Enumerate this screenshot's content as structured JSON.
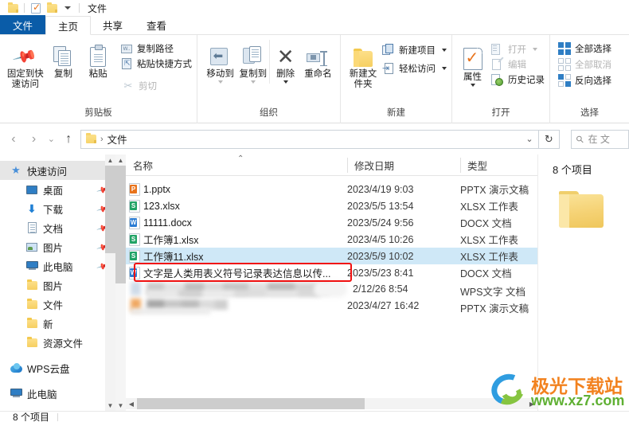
{
  "titlebar": {
    "title": "文件",
    "qat": [
      {
        "name": "folder-icon",
        "label": "文件夹"
      },
      {
        "name": "properties-icon",
        "label": "属性"
      },
      {
        "name": "folder-icon",
        "label": "新建文件夹"
      },
      {
        "name": "chevron-down-icon",
        "label": "自定义快速访问工具栏"
      }
    ]
  },
  "tabs": [
    {
      "id": "file",
      "label": "文件"
    },
    {
      "id": "home",
      "label": "主页"
    },
    {
      "id": "share",
      "label": "共享"
    },
    {
      "id": "view",
      "label": "查看"
    }
  ],
  "ribbon": {
    "groups": [
      {
        "id": "clipboard",
        "label": "剪贴板",
        "big": [
          {
            "label": "固定到快速访问",
            "icon": "pin-icon"
          },
          {
            "label": "复制",
            "icon": "copy-icon"
          },
          {
            "label": "粘贴",
            "icon": "paste-icon",
            "caret": true
          }
        ],
        "small": [
          {
            "label": "复制路径",
            "icon": "copy-path-icon"
          },
          {
            "label": "粘贴快捷方式",
            "icon": "paste-shortcut-icon"
          },
          {
            "label": "剪切",
            "icon": "scissors-icon",
            "dim": true
          }
        ]
      },
      {
        "id": "organize",
        "label": "组织",
        "big": [
          {
            "label": "移动到",
            "icon": "move-to-icon",
            "caret": true
          },
          {
            "label": "复制到",
            "icon": "copy-to-icon",
            "caret": true
          },
          {
            "label": "删除",
            "icon": "delete-icon",
            "caret": true
          },
          {
            "label": "重命名",
            "icon": "rename-icon"
          }
        ]
      },
      {
        "id": "new",
        "label": "新建",
        "big": [
          {
            "label": "新建文件夹",
            "icon": "new-folder-icon"
          }
        ],
        "small": [
          {
            "label": "新建项目",
            "icon": "new-item-icon",
            "caret": true
          },
          {
            "label": "轻松访问",
            "icon": "easy-access-icon",
            "caret": true
          }
        ]
      },
      {
        "id": "open",
        "label": "打开",
        "big": [
          {
            "label": "属性",
            "icon": "properties-icon",
            "caret": true
          }
        ],
        "small": [
          {
            "label": "打开",
            "icon": "open-icon",
            "dim": true,
            "caret": true
          },
          {
            "label": "编辑",
            "icon": "edit-icon",
            "dim": true
          },
          {
            "label": "历史记录",
            "icon": "history-icon"
          }
        ]
      },
      {
        "id": "select",
        "label": "选择",
        "small": [
          {
            "label": "全部选择",
            "icon": "select-all-icon"
          },
          {
            "label": "全部取消",
            "icon": "select-none-icon",
            "dim": true
          },
          {
            "label": "反向选择",
            "icon": "invert-selection-icon"
          }
        ]
      }
    ]
  },
  "addressbar": {
    "back": "‹",
    "forward": "›",
    "recent": "⌄",
    "up": "↑",
    "crumb_icon": "folder-icon",
    "crumb": "文件",
    "separator": "›",
    "dropdown": "⌄",
    "refresh": "↻",
    "search_placeholder": "在 文"
  },
  "sidebar": {
    "items": [
      {
        "label": "快速访问",
        "icon": "star-icon",
        "level": "root",
        "selected": true,
        "pinned": false
      },
      {
        "label": "桌面",
        "icon": "desktop-icon",
        "level": "2",
        "pinned": true
      },
      {
        "label": "下载",
        "icon": "download-icon",
        "level": "2",
        "pinned": true
      },
      {
        "label": "文档",
        "icon": "document-icon",
        "level": "2",
        "pinned": true
      },
      {
        "label": "图片",
        "icon": "pictures-icon",
        "level": "2",
        "pinned": true
      },
      {
        "label": "此电脑",
        "icon": "this-pc-icon",
        "level": "2",
        "pinned": true
      },
      {
        "label": "图片",
        "icon": "folder-icon",
        "level": "2",
        "pinned": false
      },
      {
        "label": "文件",
        "icon": "folder-icon",
        "level": "2",
        "pinned": false
      },
      {
        "label": "新",
        "icon": "folder-icon",
        "level": "2",
        "pinned": false
      },
      {
        "label": "资源文件",
        "icon": "folder-icon",
        "level": "2",
        "pinned": false
      },
      {
        "label": "WPS云盘",
        "icon": "cloud-icon",
        "level": "root",
        "pinned": false
      },
      {
        "label": "此电脑",
        "icon": "this-pc-icon",
        "level": "root",
        "pinned": false
      }
    ]
  },
  "filelist": {
    "columns": [
      {
        "id": "name",
        "label": "名称",
        "sorted": "asc"
      },
      {
        "id": "date",
        "label": "修改日期"
      },
      {
        "id": "type",
        "label": "类型"
      }
    ],
    "rows": [
      {
        "name": "1.pptx",
        "date": "2023/4/19 9:03",
        "type": "PPTX 演示文稿",
        "icon": "pptx-file-icon",
        "badge": "P",
        "selected": false,
        "blurred": false
      },
      {
        "name": "123.xlsx",
        "date": "2023/5/5 13:54",
        "type": "XLSX 工作表",
        "icon": "xlsx-file-icon",
        "badge": "S",
        "selected": false,
        "blurred": false
      },
      {
        "name": "11111.docx",
        "date": "2023/5/24 9:56",
        "type": "DOCX 文档",
        "icon": "docx-file-icon",
        "badge": "W",
        "selected": false,
        "blurred": false
      },
      {
        "name": "工作簿1.xlsx",
        "date": "2023/4/5 10:26",
        "type": "XLSX 工作表",
        "icon": "xlsx-file-icon",
        "badge": "S",
        "selected": false,
        "blurred": false
      },
      {
        "name": "工作簿11.xlsx",
        "date": "2023/5/9 10:02",
        "type": "XLSX 工作表",
        "icon": "xlsx-file-icon",
        "badge": "S",
        "selected": true,
        "blurred": false
      },
      {
        "name": "文字是人类用表义符号记录表达信息以传...",
        "date": "2023/5/23 8:41",
        "type": "DOCX 文档",
        "icon": "docx-file-icon",
        "badge": "W",
        "selected": false,
        "blurred": false,
        "highlighted": true
      },
      {
        "name": "",
        "date": "2/12/26 8:54",
        "type": "WPS文字 文档",
        "icon": "wps-file-icon",
        "badge": "",
        "selected": false,
        "blurred": true
      },
      {
        "name": "",
        "date": "2023/4/27 16:42",
        "type": "PPTX 演示文稿",
        "icon": "pptx-file-icon",
        "badge": "",
        "selected": false,
        "blurred": true
      }
    ]
  },
  "details": {
    "count": "8 个项目",
    "preview_icon": "folder-icon"
  },
  "statusbar": {
    "count": "8 个项目"
  },
  "watermark": {
    "line1": "极光下载站",
    "line2": "www.xz7.com"
  },
  "colors": {
    "file_tab": "#0a5ca8",
    "selection": "#cfe8f7",
    "highlight_box": "#f01010",
    "folder_yellow": "#f5d274"
  }
}
